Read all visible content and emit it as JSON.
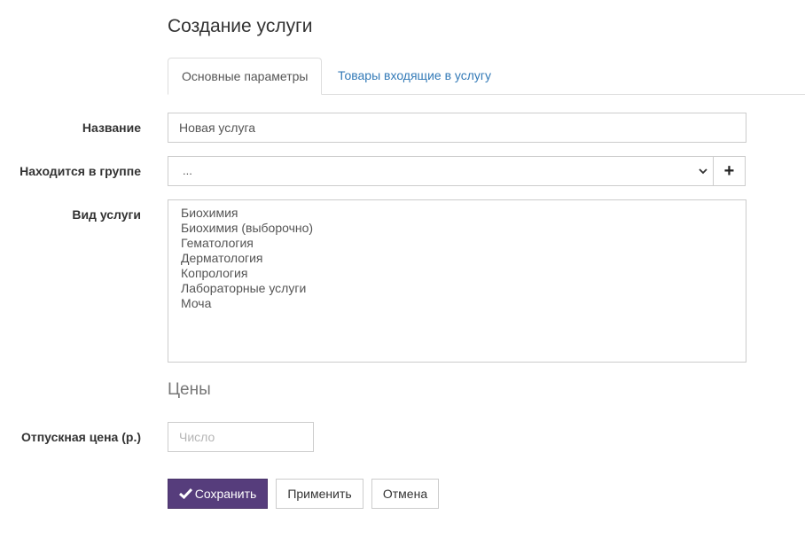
{
  "page": {
    "title": "Создание услуги"
  },
  "tabs": [
    {
      "label": "Основные параметры",
      "active": true
    },
    {
      "label": "Товары входящие в услугу",
      "active": false
    }
  ],
  "form": {
    "name": {
      "label": "Название",
      "value": "Новая услуга"
    },
    "group": {
      "label": "Находится в группе",
      "selected": "..."
    },
    "service_type": {
      "label": "Вид услуги",
      "options": [
        "Биохимия",
        "Биохимия (выборочно)",
        "Гематология",
        "Дерматология",
        "Копрология",
        "Лабораторные услуги",
        "Моча"
      ]
    }
  },
  "prices": {
    "title": "Цены",
    "sale_price": {
      "label": "Отпускная цена (р.)",
      "placeholder": "Число"
    }
  },
  "buttons": {
    "save": "Сохранить",
    "apply": "Применить",
    "cancel": "Отмена"
  },
  "colors": {
    "primary": "#563d7c",
    "link": "#337ab7",
    "border": "#cccccc"
  },
  "icons": {
    "add": "plus-icon",
    "save": "check-icon",
    "select": "chevron-down-icon"
  }
}
